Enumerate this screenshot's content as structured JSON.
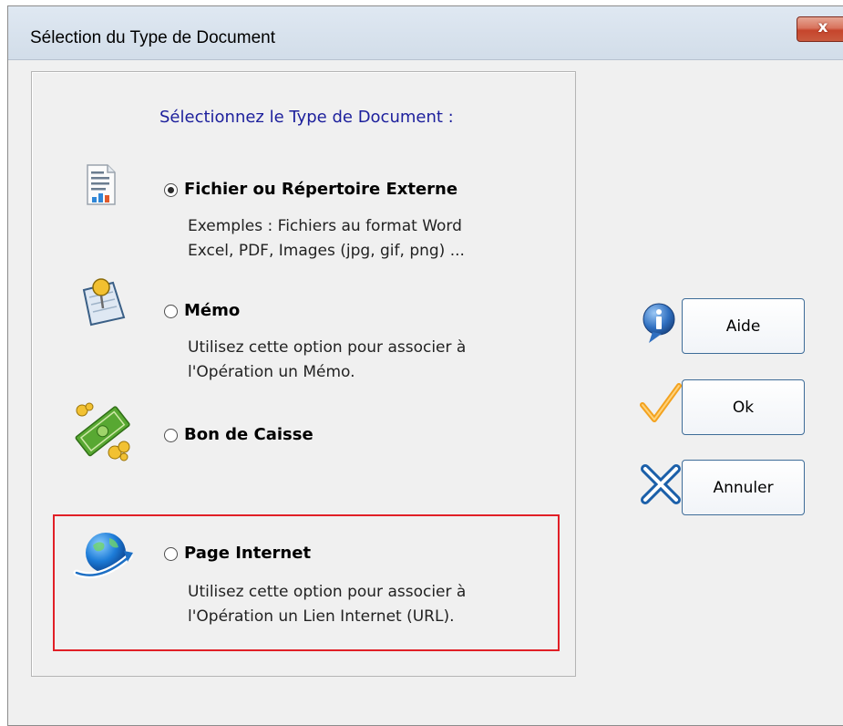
{
  "window": {
    "title": "Sélection du Type de Document",
    "close_label": "x"
  },
  "prompt": "Sélectionnez le Type de Document :",
  "options": [
    {
      "label": "Fichier ou Répertoire Externe",
      "checked": true,
      "icon": "document-chart-icon",
      "description": [
        "Exemples : Fichiers au format Word",
        "Excel, PDF, Images (jpg, gif, png) ..."
      ]
    },
    {
      "label": "Mémo",
      "checked": false,
      "icon": "pinned-note-icon",
      "description": [
        "Utilisez cette option pour associer à",
        "l'Opération un Mémo."
      ]
    },
    {
      "label": "Bon de Caisse",
      "checked": false,
      "icon": "money-coins-icon",
      "description": []
    },
    {
      "label": "Page Internet",
      "checked": false,
      "icon": "globe-internet-icon",
      "description": [
        "Utilisez cette option pour associer à",
        "l'Opération un Lien Internet (URL)."
      ]
    }
  ],
  "buttons": {
    "help": "Aide",
    "ok": "Ok",
    "cancel": "Annuler"
  },
  "colors": {
    "prompt": "#1c1f9c",
    "highlight_border": "#e11f26",
    "button_border": "#3e6c98"
  }
}
